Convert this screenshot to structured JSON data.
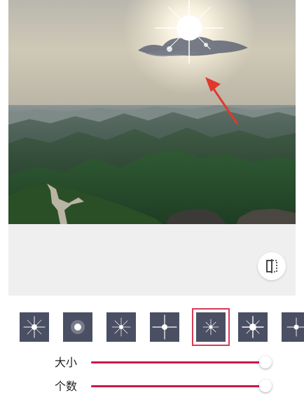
{
  "photo": {
    "description_icon": "landscape-photo-with-sun-flare",
    "annotation": "red-arrow-icon"
  },
  "compare_button": {
    "icon": "compare-split-icon"
  },
  "presets": {
    "items": [
      {
        "icon": "star-flare-4-point-icon"
      },
      {
        "icon": "star-flare-soft-glow-icon"
      },
      {
        "icon": "star-flare-thin-rays-icon"
      },
      {
        "icon": "star-flare-long-rays-icon"
      },
      {
        "icon": "star-flare-small-rays-icon"
      },
      {
        "icon": "star-flare-bright-icon"
      },
      {
        "icon": "star-flare-partial-icon"
      }
    ],
    "selected_index": 4
  },
  "sliders": {
    "size": {
      "label": "大小",
      "value": 0.98
    },
    "count": {
      "label": "个数",
      "value": 0.98
    }
  },
  "colors": {
    "accent": "#c8194a",
    "selected_border": "#d93a57",
    "tile_bg": "#4a4f63"
  }
}
